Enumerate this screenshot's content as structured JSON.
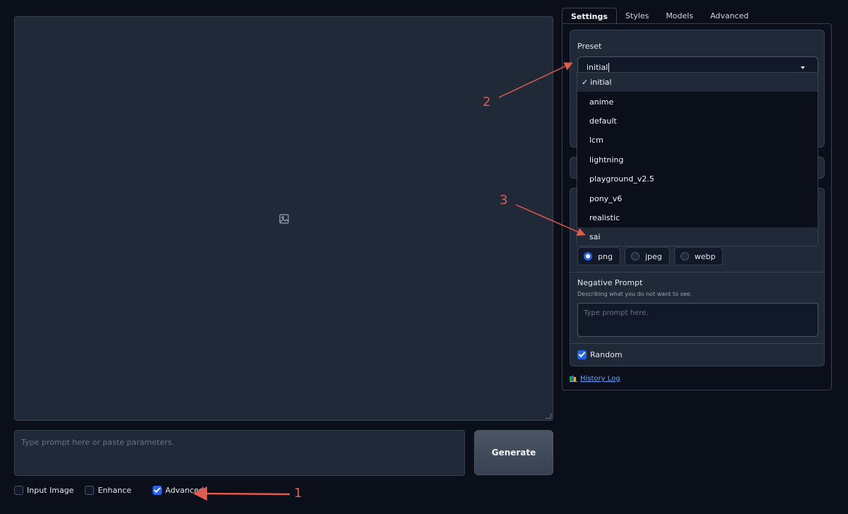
{
  "tabs": [
    "Settings",
    "Styles",
    "Models",
    "Advanced"
  ],
  "active_tab": "Settings",
  "image_area": {
    "icon": "image-icon"
  },
  "prompt": {
    "placeholder": "Type prompt here or paste parameters."
  },
  "generate": {
    "label": "Generate"
  },
  "bottom_checks": [
    {
      "label": "Input Image",
      "checked": false
    },
    {
      "label": "Enhance",
      "checked": false
    },
    {
      "label": "Advanced",
      "checked": true
    }
  ],
  "preset": {
    "label": "Preset",
    "value": "initial",
    "options": [
      "initial",
      "anime",
      "default",
      "lcm",
      "lightning",
      "playground_v2.5",
      "pony_v6",
      "realistic",
      "sai"
    ],
    "check_mark": "✓"
  },
  "formats": [
    {
      "label": "png",
      "selected": true
    },
    {
      "label": "jpeg",
      "selected": false
    },
    {
      "label": "webp",
      "selected": false
    }
  ],
  "negative_prompt": {
    "title": "Negative Prompt",
    "subtitle": "Describing what you do not want to see.",
    "placeholder": "Type prompt here."
  },
  "random": {
    "label": "Random",
    "checked": true
  },
  "history": {
    "label": "History Log",
    "icon": "book-icon"
  },
  "annotations": [
    "1",
    "2",
    "3"
  ],
  "colors": {
    "accent": "#2563eb",
    "annotation": "#e05a4e",
    "background": "#0b0f19",
    "panel": "#1f2937"
  }
}
